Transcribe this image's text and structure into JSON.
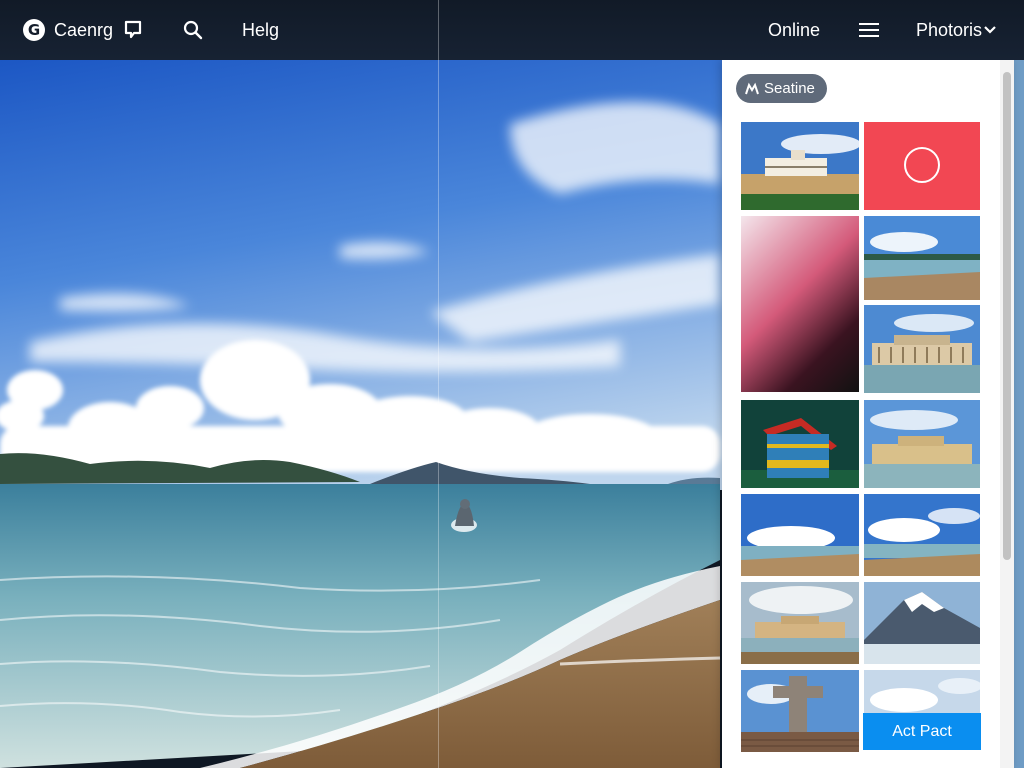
{
  "topbar": {
    "logo_letter": "G",
    "brand": "Caenrg",
    "help": "Helg",
    "online": "Online",
    "photoris": "Photoris",
    "icons": [
      "comment-icon",
      "search-icon",
      "hamburger-menu-icon",
      "chevron-down-icon"
    ]
  },
  "panel": {
    "chip_label": "Seatine",
    "action_button": "Act Pact",
    "thumbnails": [
      "palace-on-beach",
      "red-swatch-with-circle",
      "pink-to-black-gradient",
      "beach-shoreline",
      "columned-palace",
      "ornate-temple",
      "palace-waterfront",
      "beach-clouds",
      "beach-clouds-2",
      "palace-lawn",
      "snowy-mountain",
      "stone-cross",
      "sky-and-clouds"
    ]
  },
  "colors": {
    "topbar_bg": "#141d2b",
    "accent_button": "#0a8ef0",
    "swatch_red": "#f24753",
    "chip_bg": "#5f6a7a"
  }
}
